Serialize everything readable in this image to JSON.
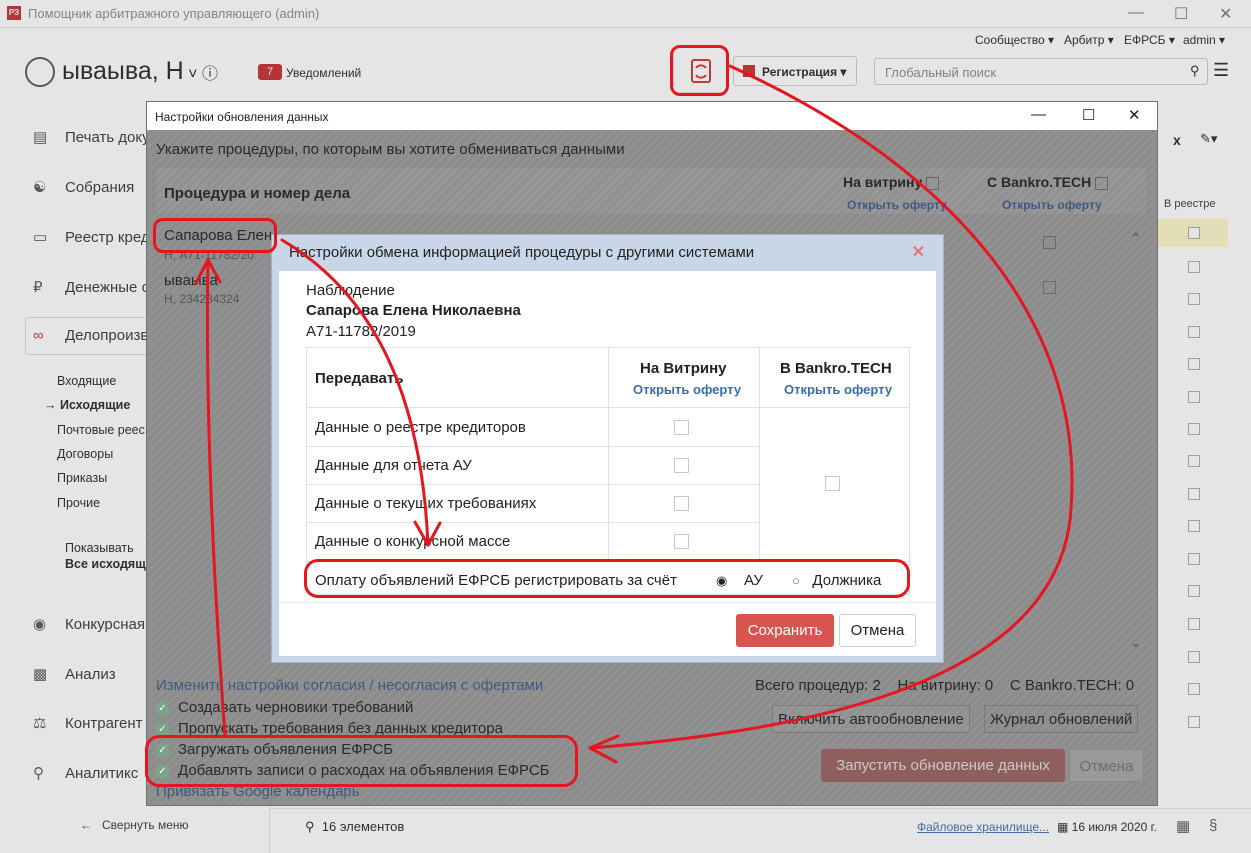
{
  "window": {
    "title": "Помощник арбитражного управляющего (admin)",
    "logo": "РЗ"
  },
  "topmenu": {
    "community": "Сообщество",
    "arbiter": "Арбитр",
    "efrsb": "ЕФРСБ",
    "admin": "admin"
  },
  "header": {
    "user_name": "ываыва, Н",
    "notif_count": "7",
    "notif_label": "Уведомлений",
    "registration": "Регистрация",
    "search_placeholder": "Глобальный поиск"
  },
  "sidebar": {
    "items": [
      {
        "label": "Печать доку",
        "icon": "document-icon"
      },
      {
        "label": "Собрания",
        "icon": "handshake-icon"
      },
      {
        "label": "Реестр кред",
        "icon": "id-card-icon"
      },
      {
        "label": "Денежные с",
        "icon": "ruble-icon"
      },
      {
        "label": "Делопроизв",
        "icon": "paperclip-icon"
      },
      {
        "label": "Конкурсная",
        "icon": "piggy-bank-icon"
      },
      {
        "label": "Анализ",
        "icon": "bar-chart-icon"
      },
      {
        "label": "Контрагент",
        "icon": "bank-icon"
      },
      {
        "label": "Аналитикс",
        "icon": "search-analytics-icon"
      }
    ],
    "sub": [
      "Входящие",
      "→ Исходящие",
      "Почтовые реес",
      "Договоры",
      "Приказы",
      "Прочие"
    ],
    "show_label": "Показывать",
    "show_value": "Все исходящ",
    "collapse": "Свернуть меню"
  },
  "bottom": {
    "count": "16 элементов",
    "storage": "Файловое хранилище...",
    "date": "16 июля 2020 г."
  },
  "right_col": {
    "header": "В реестре",
    "x_label": "x"
  },
  "dialog1": {
    "title": "Настройки обновления данных",
    "instruction": "Укажите процедуры, по которым вы хотите обмениваться данными",
    "col_proc": "Процедура и номер дела",
    "col_vitrina": "На витрину",
    "col_bankro": "С Bankro.TECH",
    "offer_link": "Открыть оферту",
    "rows": [
      {
        "name": "Сапарова Елен",
        "case": "Н, А71-11782/20"
      },
      {
        "name": "ываыва",
        "case": "Н, 234234324"
      }
    ],
    "change_consent": "Изменить настройки согласия / несогласия с офертами",
    "checks": [
      "Создавать черновики требований",
      "Пропускать требования без данных кредитора",
      "Загружать объявления ЕФРСБ",
      "Добавлять записи о расходах на объявления ЕФРСБ"
    ],
    "google": "Привязать Google календарь",
    "summary": "Всего процедур: 2    На витрину: 0    С Bankro.TECH: 0",
    "auto_update": "Включить автообновление",
    "journal": "Журнал обновлений",
    "run": "Запустить обновление данных",
    "cancel": "Отмена"
  },
  "dialog2": {
    "title": "Настройки обмена информацией процедуры с другими системами",
    "proc_type": "Наблюдение",
    "proc_name": "Сапарова Елена Николаевна",
    "proc_case": "А71-11782/2019",
    "col_transfer": "Передавать",
    "col_vitrina": "На Витрину",
    "col_bankro": "В Bankro.TECH",
    "offer_link": "Открыть оферту",
    "rows": [
      "Данные о реестре кредиторов",
      "Данные для отчета АУ",
      "Данные о текущих требованиях",
      "Данные о конкурсной массе"
    ],
    "payment_label": "Оплату объявлений ЕФРСБ регистрировать за счёт",
    "opt_au": "АУ",
    "opt_debtor": "Должника",
    "save": "Сохранить",
    "cancel": "Отмена"
  },
  "colors": {
    "accent_red": "#d9534f",
    "annotation_red": "#e5161f",
    "link_blue": "#3a6da7"
  }
}
